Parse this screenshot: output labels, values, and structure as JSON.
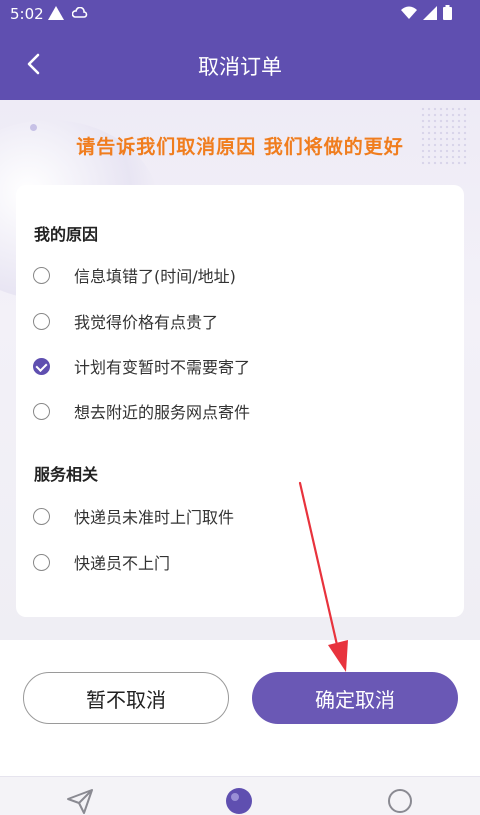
{
  "status_bar": {
    "time": "5:02"
  },
  "header": {
    "title": "取消订单"
  },
  "slogan": "请告诉我们取消原因 我们将做的更好",
  "sections": [
    {
      "title": "我的原因",
      "options": [
        {
          "label": "信息填错了(时间/地址)",
          "checked": false
        },
        {
          "label": "我觉得价格有点贵了",
          "checked": false
        },
        {
          "label": "计划有变暂时不需要寄了",
          "checked": true
        },
        {
          "label": "想去附近的服务网点寄件",
          "checked": false
        }
      ]
    },
    {
      "title": "服务相关",
      "options": [
        {
          "label": "快递员未准时上门取件",
          "checked": false
        },
        {
          "label": "快递员不上门",
          "checked": false
        }
      ]
    }
  ],
  "buttons": {
    "keep": "暂不取消",
    "confirm": "确定取消"
  },
  "tabbar": {
    "icons": [
      "send-icon",
      "query-icon",
      "profile-icon"
    ]
  },
  "colors": {
    "primary": "#5f4fb0",
    "accent_orange": "#f07d1e",
    "arrow_red": "#e8333d"
  }
}
